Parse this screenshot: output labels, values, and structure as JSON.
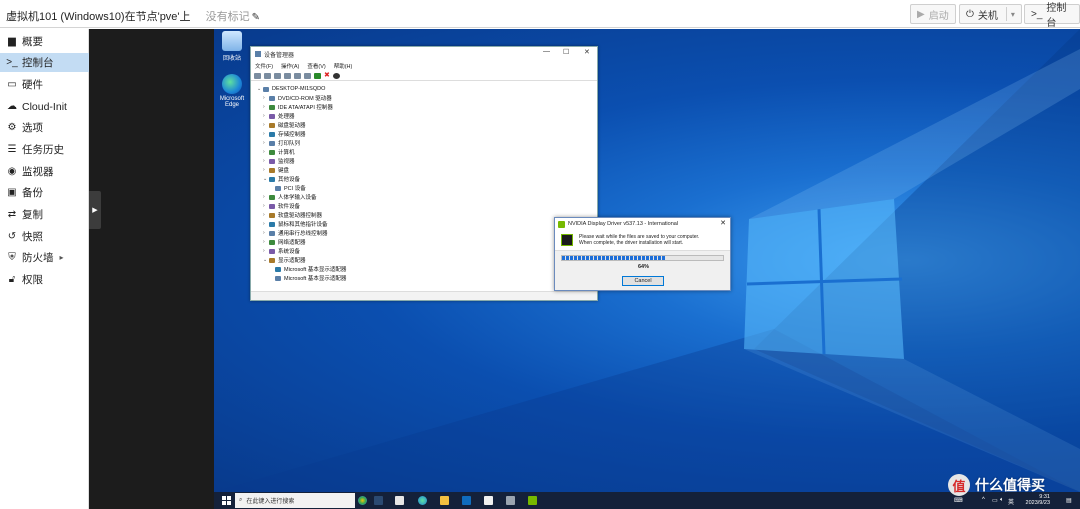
{
  "header": {
    "vm_title": "虚拟机101 (Windows10)在节点'pve'上",
    "no_tag": "没有标记",
    "start_label": "启动",
    "shutdown_label": "关机",
    "console_label": "控制台"
  },
  "sidebar": {
    "items": [
      {
        "label": "概要",
        "icon": "book-icon"
      },
      {
        "label": "控制台",
        "icon": "terminal-icon"
      },
      {
        "label": "硬件",
        "icon": "monitor-icon"
      },
      {
        "label": "Cloud-Init",
        "icon": "cloud-icon"
      },
      {
        "label": "选项",
        "icon": "gear-icon"
      },
      {
        "label": "任务历史",
        "icon": "list-icon"
      },
      {
        "label": "监视器",
        "icon": "eye-icon"
      },
      {
        "label": "备份",
        "icon": "floppy-icon"
      },
      {
        "label": "复制",
        "icon": "retweet-icon"
      },
      {
        "label": "快照",
        "icon": "history-icon"
      },
      {
        "label": "防火墙",
        "icon": "shield-icon"
      },
      {
        "label": "权限",
        "icon": "unlock-icon"
      }
    ],
    "active_index": 1
  },
  "desktop": {
    "icons": [
      {
        "label": "回收站"
      },
      {
        "label": "Microsoft Edge"
      }
    ]
  },
  "device_manager": {
    "title": "设备管理器",
    "menu": [
      "文件(F)",
      "操作(A)",
      "查看(V)",
      "帮助(H)"
    ],
    "root": "DESKTOP-MI1SQDO",
    "nodes": [
      {
        "label": "DVD/CD-ROM 驱动器",
        "exp": "›",
        "level": 1
      },
      {
        "label": "IDE ATA/ATAPI 控制器",
        "exp": "›",
        "level": 1
      },
      {
        "label": "处理器",
        "exp": "›",
        "level": 1
      },
      {
        "label": "磁盘驱动器",
        "exp": "›",
        "level": 1
      },
      {
        "label": "存储控制器",
        "exp": "›",
        "level": 1
      },
      {
        "label": "打印队列",
        "exp": "›",
        "level": 1
      },
      {
        "label": "计算机",
        "exp": "›",
        "level": 1
      },
      {
        "label": "监视器",
        "exp": "›",
        "level": 1
      },
      {
        "label": "键盘",
        "exp": "›",
        "level": 1
      },
      {
        "label": "其他设备",
        "exp": "⌄",
        "level": 1
      },
      {
        "label": "PCI 设备",
        "exp": "",
        "level": 2
      },
      {
        "label": "人体学输入设备",
        "exp": "›",
        "level": 1
      },
      {
        "label": "软件设备",
        "exp": "›",
        "level": 1
      },
      {
        "label": "软盘驱动器控制器",
        "exp": "›",
        "level": 1
      },
      {
        "label": "鼠标和其他指针设备",
        "exp": "›",
        "level": 1
      },
      {
        "label": "通用串行总线控制器",
        "exp": "›",
        "level": 1
      },
      {
        "label": "网络适配器",
        "exp": "›",
        "level": 1
      },
      {
        "label": "系统设备",
        "exp": "›",
        "level": 1
      },
      {
        "label": "显示适配器",
        "exp": "⌄",
        "level": 1
      },
      {
        "label": "Microsoft 基本显示适配器",
        "exp": "",
        "level": 2
      },
      {
        "label": "Microsoft 基本显示适配器",
        "exp": "",
        "level": 2
      }
    ]
  },
  "nvidia_dialog": {
    "title": "NVIDIA Display Driver v537.13 - International",
    "message_line1": "Please wait while the files are saved to your computer.",
    "message_line2": "When complete, the driver installation will start.",
    "progress_percent": 64,
    "progress_label": "64%",
    "cancel_label": "Cancel",
    "accent_color": "#76b900"
  },
  "taskbar": {
    "search_placeholder": "在此键入进行搜索",
    "ime_label": "英",
    "time": "9:31",
    "date": "2023/9/23"
  },
  "watermark": {
    "logo_char": "值",
    "text": "什么值得买"
  }
}
